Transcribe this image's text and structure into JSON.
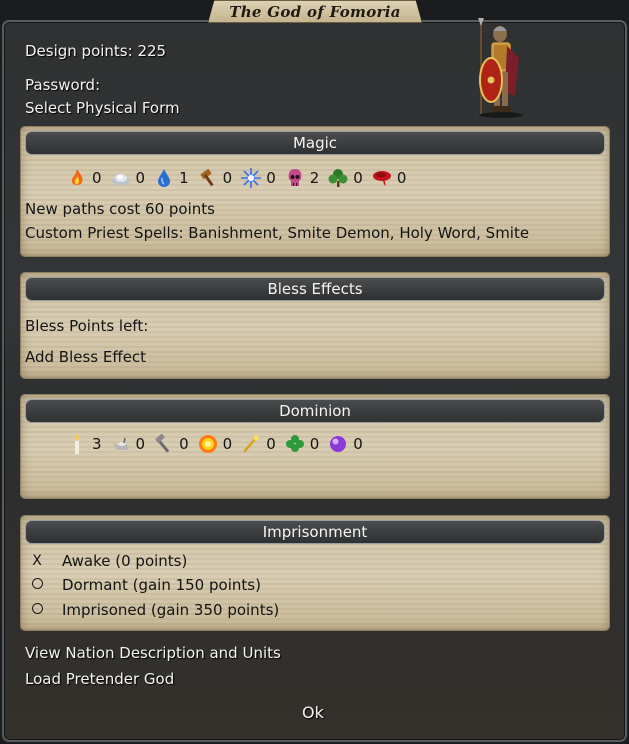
{
  "window": {
    "title": "The God of Fomoria"
  },
  "design_points": "Design points: 225",
  "password_label": "Password:",
  "select_form": "Select Physical Form",
  "magic": {
    "header": "Magic",
    "paths": [
      {
        "icon": "fire-icon",
        "value": "0"
      },
      {
        "icon": "air-icon",
        "value": "0"
      },
      {
        "icon": "water-icon",
        "value": "1"
      },
      {
        "icon": "earth-icon",
        "value": "0"
      },
      {
        "icon": "astral-icon",
        "value": "0"
      },
      {
        "icon": "death-icon",
        "value": "2"
      },
      {
        "icon": "nature-icon",
        "value": "0"
      },
      {
        "icon": "blood-icon",
        "value": "0"
      }
    ],
    "new_paths_cost": "New paths cost 60 points",
    "custom_spells": "Custom Priest Spells: Banishment, Smite Demon, Holy Word, Smite"
  },
  "bless": {
    "header": "Bless Effects",
    "points_left": "Bless Points left:",
    "add_effect": "Add Bless Effect"
  },
  "dominion": {
    "header": "Dominion",
    "scales": [
      {
        "icon": "candle-icon",
        "value": "3"
      },
      {
        "icon": "lamp-icon",
        "value": "0"
      },
      {
        "icon": "hammer-icon",
        "value": "0"
      },
      {
        "icon": "sun-icon",
        "value": "0"
      },
      {
        "icon": "wand-icon",
        "value": "0"
      },
      {
        "icon": "clover-icon",
        "value": "0"
      },
      {
        "icon": "orb-icon",
        "value": "0"
      }
    ]
  },
  "imprisonment": {
    "header": "Imprisonment",
    "options": [
      {
        "mark": "X",
        "label": "Awake (0 points)"
      },
      {
        "mark": "",
        "label": "Dormant (gain 150 points)"
      },
      {
        "mark": "",
        "label": "Imprisoned (gain 350 points)"
      }
    ]
  },
  "view_nation": "View Nation Description and Units",
  "load_pretender": "Load Pretender God",
  "ok_label": "Ok",
  "colors": {
    "panel": "#d4c7aa",
    "header": "#3a3c3e",
    "window": "#323435"
  }
}
